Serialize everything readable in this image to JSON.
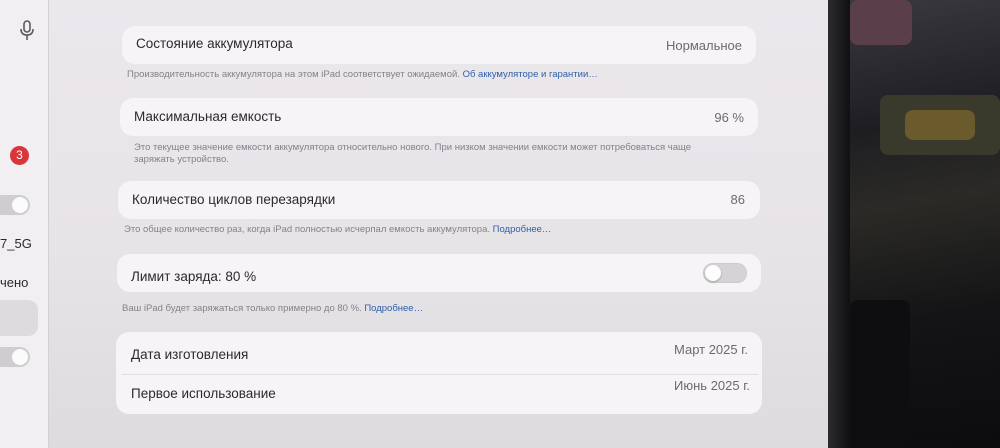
{
  "sidebar": {
    "badge_count": "3",
    "wifi_suffix": "7_5G",
    "bluetooth_status": "чено"
  },
  "battery": {
    "health": {
      "label": "Состояние аккумулятора",
      "value": "Нормальное",
      "footnote": "Производительность аккумулятора на этом iPad соответствует ожидаемой.",
      "link": "Об аккумуляторе и гарантии…"
    },
    "max_capacity": {
      "label": "Максимальная емкость",
      "value": "96 %",
      "footnote_line1": "Это текущее значение емкости аккумулятора относительно нового. При низком значении емкости может потребоваться чаще",
      "footnote_line2": "заряжать устройство."
    },
    "cycle_count": {
      "label": "Количество циклов перезарядки",
      "value": "86",
      "footnote": "Это общее количество раз, когда iPad полностью исчерпал емкость аккумулятора.",
      "link": "Подробнее…"
    },
    "charge_limit": {
      "label": "Лимит заряда: 80 %",
      "toggle_on": false,
      "footnote": "Ваш iPad будет заряжаться только примерно до 80 %.",
      "link": "Подробнее…"
    },
    "manufacture": {
      "label": "Дата изготовления",
      "value": "Март 2025 г."
    },
    "first_use": {
      "label": "Первое использование",
      "value": "Июнь 2025 г."
    }
  },
  "colors": {
    "link": "#2f5fa8",
    "badge": "#d9363c"
  }
}
